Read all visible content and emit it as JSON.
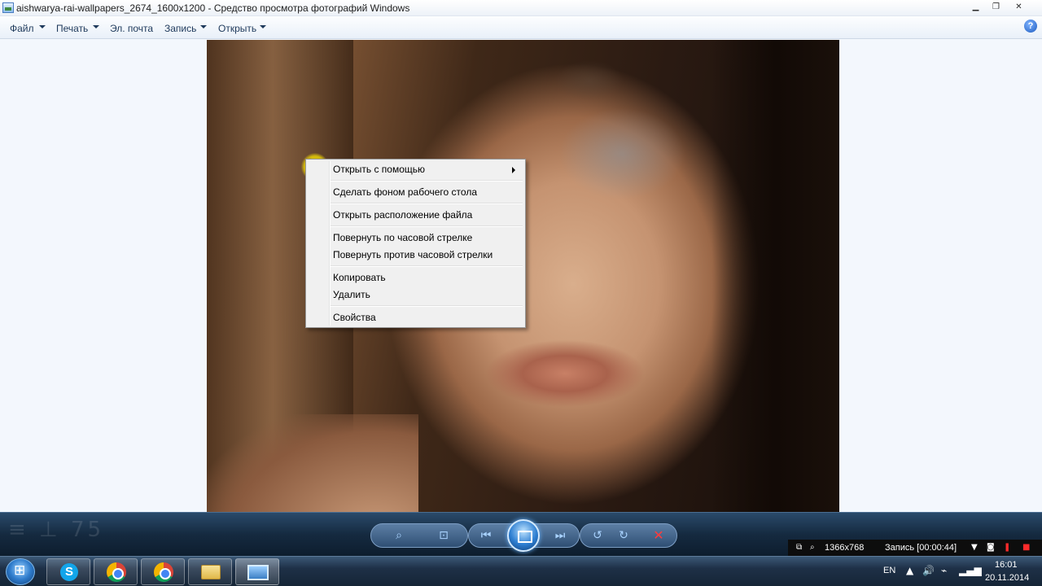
{
  "window": {
    "title": "aishwarya-rai-wallpapers_2674_1600x1200 - Средство просмотра фотографий Windows",
    "controls": {
      "minimize": "▁",
      "maximize": "❐",
      "close": "✕"
    }
  },
  "menubar": {
    "items": [
      {
        "label": "Файл",
        "dropdown": true
      },
      {
        "label": "Печать",
        "dropdown": true
      },
      {
        "label": "Эл. почта",
        "dropdown": false
      },
      {
        "label": "Запись",
        "dropdown": true
      },
      {
        "label": "Открыть",
        "dropdown": true
      }
    ],
    "help": "?"
  },
  "context_menu": {
    "items": [
      {
        "label": "Открыть с помощью",
        "has_submenu": true
      },
      {
        "label": "Сделать фоном рабочего стола"
      },
      {
        "label": "Открыть расположение файла"
      },
      {
        "label": "Повернуть по часовой стрелке"
      },
      {
        "label": "Повернуть против часовой стрелки"
      },
      {
        "label": "Копировать"
      },
      {
        "label": "Удалить"
      },
      {
        "label": "Свойства"
      }
    ]
  },
  "navbar": {
    "icons": [
      "zoom-icon",
      "actual-size-icon",
      "previous-icon",
      "slideshow-icon",
      "next-icon",
      "rotate-counterclockwise-icon",
      "rotate-clockwise-icon",
      "delete-icon"
    ],
    "deco_text": "≡ ⊥ 75",
    "accent_color": "#2e7fd2",
    "delete_color": "#ff3b3b"
  },
  "recorder": {
    "resolution": "1366x768",
    "status": "Запись [00:00:44]"
  },
  "tray": {
    "language": "EN",
    "time": "16:01",
    "date": "20.11.2014"
  }
}
